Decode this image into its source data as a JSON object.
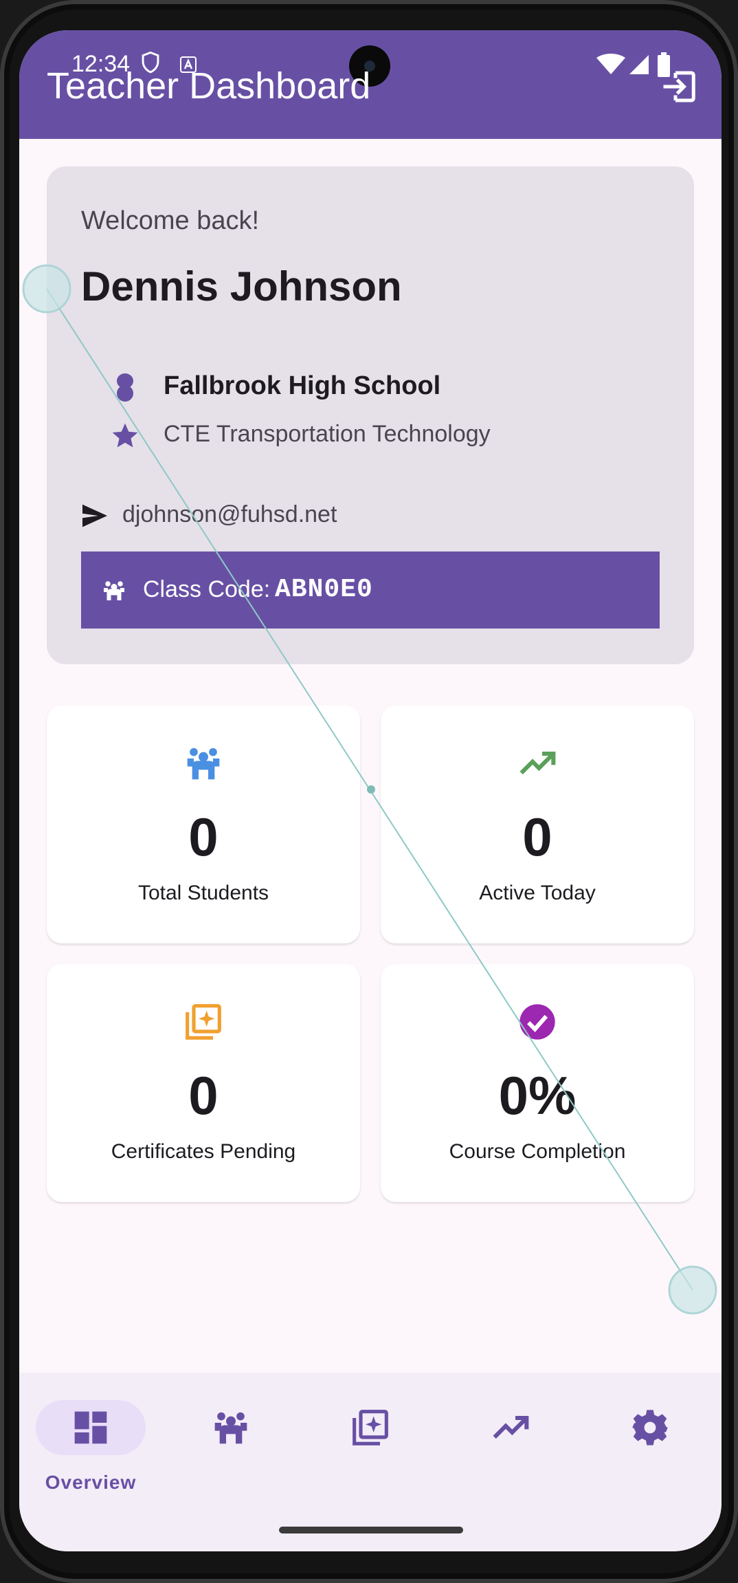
{
  "status_bar": {
    "time": "12:34"
  },
  "app_bar": {
    "title": "Teacher Dashboard",
    "logout_icon": "logout-icon"
  },
  "welcome": {
    "greeting": "Welcome back!",
    "name": "Dennis Johnson",
    "school": "Fallbrook High School",
    "program": "CTE Transportation Technology",
    "email": "djohnson@fuhsd.net",
    "class_code_label": "Class Code:",
    "class_code_value": "ABN0E0"
  },
  "stats": [
    {
      "value": "0",
      "label": "Total Students",
      "icon": "students-icon",
      "color": "#4a90e2"
    },
    {
      "value": "0",
      "label": "Active Today",
      "icon": "trending-up-icon",
      "color": "#5aa05a"
    },
    {
      "value": "0",
      "label": "Certificates Pending",
      "icon": "certificate-icon",
      "color": "#f0a030"
    },
    {
      "value": "0%",
      "label": "Course Completion",
      "icon": "check-circle-icon",
      "color": "#9c27b0"
    }
  ],
  "bottom_nav": {
    "items": [
      {
        "label": "Overview",
        "icon": "dashboard-icon",
        "selected": true
      },
      {
        "label": "",
        "icon": "students-icon",
        "selected": false
      },
      {
        "label": "",
        "icon": "certificate-icon",
        "selected": false
      },
      {
        "label": "",
        "icon": "trending-up-icon",
        "selected": false
      },
      {
        "label": "",
        "icon": "gear-icon",
        "selected": false
      }
    ]
  },
  "colors": {
    "primary": "#6750a4",
    "surface_variant": "#e6e0e9",
    "nav_background": "#f3edf7",
    "nav_indicator": "#e8def8"
  }
}
